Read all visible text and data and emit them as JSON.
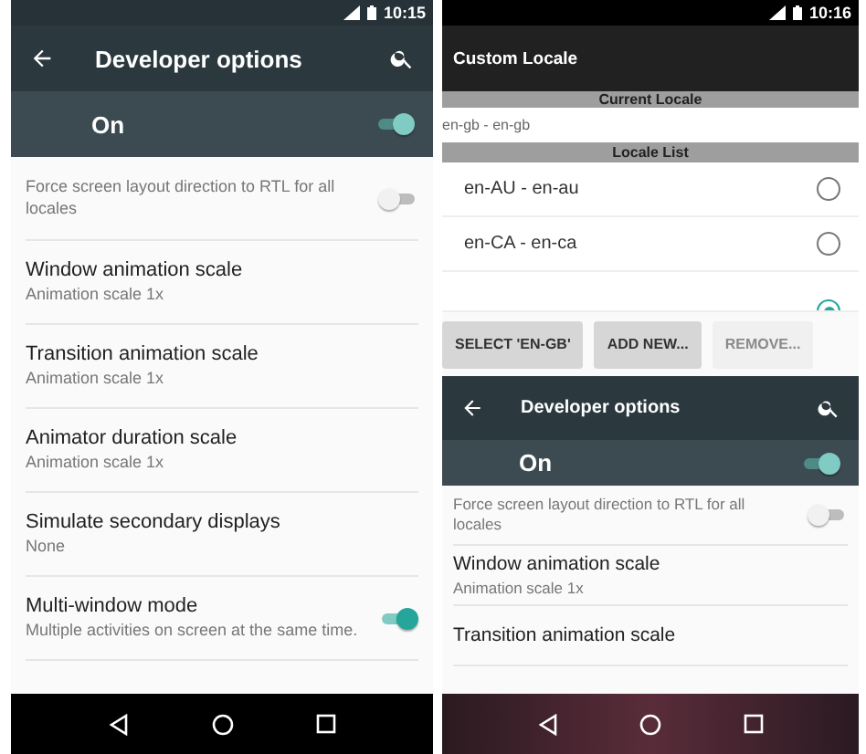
{
  "left_screen": {
    "status_bar": {
      "time": "10:15"
    },
    "toolbar": {
      "title": "Developer options"
    },
    "master_switch": {
      "label": "On",
      "on": true
    },
    "settings": [
      {
        "kind": "toggle",
        "subtitle": "Force screen layout direction to RTL for all locales",
        "on": false
      },
      {
        "kind": "plain",
        "title": "Window animation scale",
        "subtitle": "Animation scale 1x"
      },
      {
        "kind": "plain",
        "title": "Transition animation scale",
        "subtitle": "Animation scale 1x"
      },
      {
        "kind": "plain",
        "title": "Animator duration scale",
        "subtitle": "Animation scale 1x"
      },
      {
        "kind": "plain",
        "title": "Simulate secondary displays",
        "subtitle": "None"
      },
      {
        "kind": "toggle",
        "title": "Multi-window mode",
        "subtitle": "Multiple activities on screen at the same time.",
        "on": true
      }
    ]
  },
  "right_screen": {
    "status_bar": {
      "time": "10:16"
    },
    "app_bar": {
      "title": "Custom Locale"
    },
    "current_locale": {
      "heading": "Current Locale",
      "value": "en-gb - en-gb"
    },
    "locale_list": {
      "heading": "Locale List",
      "items": [
        {
          "label": "en-AU - en-au",
          "selected": false
        },
        {
          "label": "en-CA - en-ca",
          "selected": false
        },
        {
          "selected": true
        }
      ]
    },
    "buttons": [
      {
        "label": "SELECT 'EN-GB'",
        "disabled": false
      },
      {
        "label": "ADD NEW...",
        "disabled": false
      },
      {
        "label": "REMOVE...",
        "disabled": true
      }
    ],
    "overlay": {
      "toolbar": {
        "title": "Developer options"
      },
      "master_switch": {
        "label": "On",
        "on": true
      },
      "settings": [
        {
          "kind": "toggle",
          "subtitle": "Force screen layout direction to RTL for all locales",
          "on": false
        },
        {
          "kind": "plain",
          "title": "Window animation scale",
          "subtitle": "Animation scale 1x"
        },
        {
          "kind": "plain",
          "title": "Transition animation scale"
        }
      ]
    }
  }
}
